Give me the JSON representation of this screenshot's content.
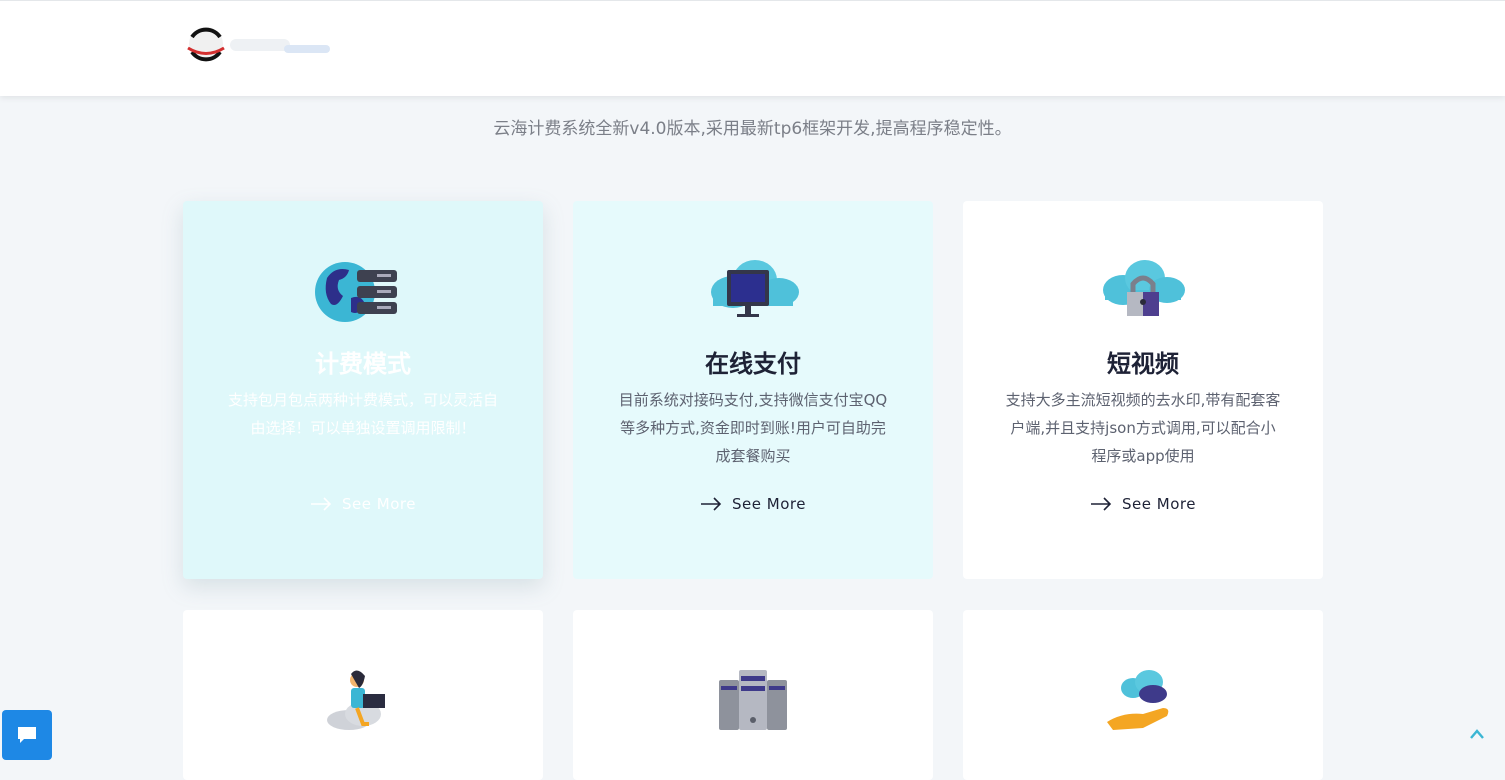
{
  "header": {
    "logo_alt": "logo"
  },
  "intro": {
    "subtitle": "云海计费系统全新v4.0版本,采用最新tp6框架开发,提高程序稳定性。"
  },
  "cards": [
    {
      "icon": "globe-server-icon",
      "title": "计费模式",
      "desc": "支持包月包点两种计费模式，可以灵活自由选择！可以单独设置调用限制！",
      "more": "See More"
    },
    {
      "icon": "cloud-monitor-icon",
      "title": "在线支付",
      "desc": "目前系统对接码支付,支持微信支付宝QQ等多种方式,资金即时到账!用户可自助完成套餐购买",
      "more": "See More"
    },
    {
      "icon": "cloud-lock-icon",
      "title": "短视频",
      "desc": "支持大多主流短视频的去水印,带有配套客户端,并且支持json方式调用,可以配合小程序或app使用",
      "more": "See More"
    },
    {
      "icon": "person-laptop-cloud-icon",
      "title": ""
    },
    {
      "icon": "server-rack-icon",
      "title": ""
    },
    {
      "icon": "hand-cloud-icon",
      "title": ""
    }
  ],
  "widgets": {
    "chat_icon": "chat-bubble-icon",
    "top_icon": "chevron-up-icon"
  },
  "colors": {
    "accent": "#1e88e5",
    "card_tint": "#e6fafc",
    "title": "#1e2236"
  }
}
